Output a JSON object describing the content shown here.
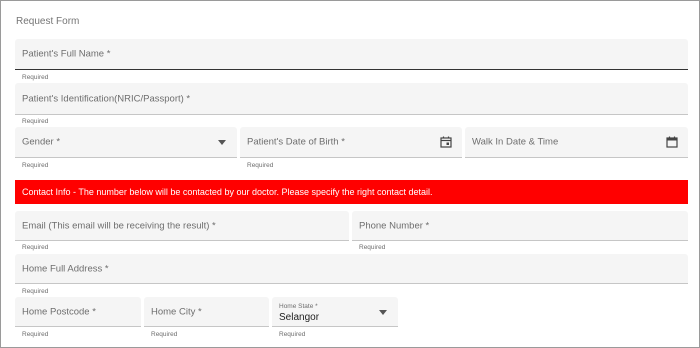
{
  "form": {
    "title": "Request Form"
  },
  "fields": {
    "full_name": {
      "label": "Patient's Full Name *",
      "helper": "Required"
    },
    "identification": {
      "label": "Patient's Identification(NRIC/Passport) *",
      "helper": "Required"
    },
    "gender": {
      "label": "Gender *",
      "helper": "Required",
      "icon": "chevron-down-icon"
    },
    "dob": {
      "label": "Patient's Date of Birth *",
      "helper": "Required",
      "icon": "calendar-icon"
    },
    "walk_in": {
      "label": "Walk In Date & Time",
      "icon": "calendar-icon"
    },
    "email": {
      "label": "Email (This email will be receiving the result) *",
      "helper": "Required"
    },
    "phone": {
      "label": "Phone Number *",
      "helper": "Required"
    },
    "address": {
      "label": "Home Full Address *",
      "helper": "Required"
    },
    "postcode": {
      "label": "Home Postcode *",
      "helper": "Required"
    },
    "city": {
      "label": "Home City *",
      "helper": "Required"
    },
    "state": {
      "label": "Home State *",
      "value": "Selangor",
      "helper": "Required",
      "icon": "chevron-down-icon"
    }
  },
  "alert": {
    "text": "Contact Info - The number below will be contacted by our doctor. Please specify the right contact detail.",
    "color": "#ff0000"
  }
}
